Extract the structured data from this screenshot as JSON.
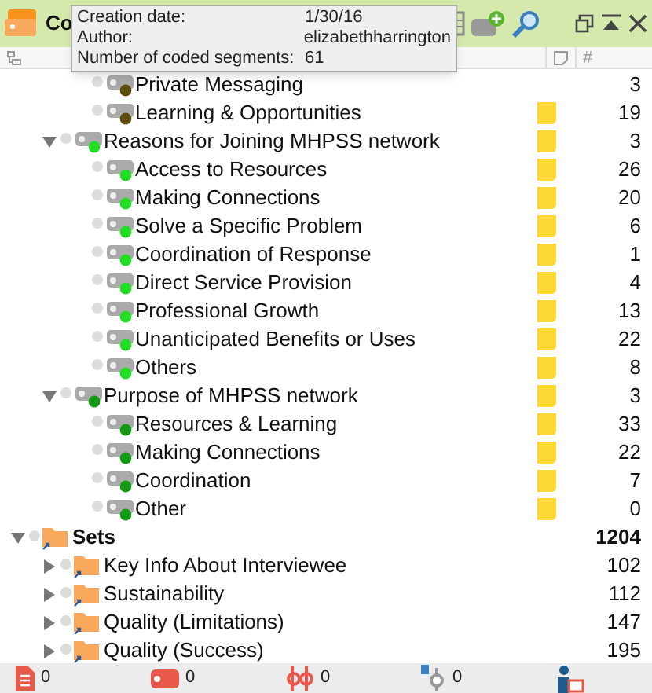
{
  "window": {
    "title": "Co"
  },
  "tooltip": {
    "rows": [
      {
        "label": "Creation date:",
        "value": "1/30/16"
      },
      {
        "label": "Author:",
        "value": "elizabethharrington"
      },
      {
        "label": "Number of coded segments:",
        "value": "61"
      }
    ]
  },
  "columns": {
    "number_header": "#"
  },
  "tree": [
    {
      "children": [
        {
          "children": [
            {
              "kind": "code",
              "label": "Private Messaging",
              "color": "#5c4d0a",
              "memo": false,
              "count": "3"
            },
            {
              "kind": "code",
              "label": "Learning & Opportunities",
              "color": "#5c4d0a",
              "memo": true,
              "count": "19"
            }
          ]
        },
        {
          "kind": "code",
          "label": "Reasons for Joining MHPSS network",
          "color": "#22dd22",
          "memo": true,
          "count": "3",
          "expanded": true,
          "children": [
            {
              "kind": "code",
              "label": "Access to Resources",
              "color": "#22dd22",
              "memo": true,
              "count": "26"
            },
            {
              "kind": "code",
              "label": "Making Connections",
              "color": "#22dd22",
              "memo": true,
              "count": "20"
            },
            {
              "kind": "code",
              "label": "Solve a Specific Problem",
              "color": "#22dd22",
              "memo": true,
              "count": "6"
            },
            {
              "kind": "code",
              "label": "Coordination of Response",
              "color": "#22dd22",
              "memo": true,
              "count": "1"
            },
            {
              "kind": "code",
              "label": "Direct Service Provision",
              "color": "#22dd22",
              "memo": true,
              "count": "4"
            },
            {
              "kind": "code",
              "label": "Professional Growth",
              "color": "#22dd22",
              "memo": true,
              "count": "13"
            },
            {
              "kind": "code",
              "label": "Unanticipated Benefits or Uses",
              "color": "#22dd22",
              "memo": true,
              "count": "22"
            },
            {
              "kind": "code",
              "label": "Others",
              "color": "#22dd22",
              "memo": true,
              "count": "8"
            }
          ]
        },
        {
          "kind": "code",
          "label": "Purpose of MHPSS network",
          "color": "#129a12",
          "memo": true,
          "count": "3",
          "expanded": true,
          "children": [
            {
              "kind": "code",
              "label": "Resources & Learning",
              "color": "#129a12",
              "memo": true,
              "count": "33"
            },
            {
              "kind": "code",
              "label": "Making Connections",
              "color": "#129a12",
              "memo": true,
              "count": "22"
            },
            {
              "kind": "code",
              "label": "Coordination",
              "color": "#129a12",
              "memo": true,
              "count": "7"
            },
            {
              "kind": "code",
              "label": "Other",
              "color": "#129a12",
              "memo": true,
              "count": "0"
            }
          ]
        }
      ]
    },
    {
      "kind": "set",
      "label": "Sets",
      "bold": true,
      "memo": false,
      "count": "1204",
      "expanded": true,
      "children": [
        {
          "kind": "set",
          "label": "Key Info About Interviewee",
          "memo": false,
          "count": "102",
          "expanded": false
        },
        {
          "kind": "set",
          "label": "Sustainability",
          "memo": false,
          "count": "112",
          "expanded": false
        },
        {
          "kind": "set",
          "label": "Quality (Limitations)",
          "memo": false,
          "count": "147",
          "expanded": false
        },
        {
          "kind": "set",
          "label": "Quality (Success)",
          "memo": false,
          "count": "195",
          "expanded": false
        }
      ]
    }
  ],
  "status_bar": [
    {
      "kind": "documents",
      "count": "0"
    },
    {
      "kind": "codes",
      "count": "0"
    },
    {
      "kind": "segments",
      "count": "0"
    },
    {
      "kind": "variables",
      "count": "0"
    },
    {
      "kind": "users"
    }
  ]
}
